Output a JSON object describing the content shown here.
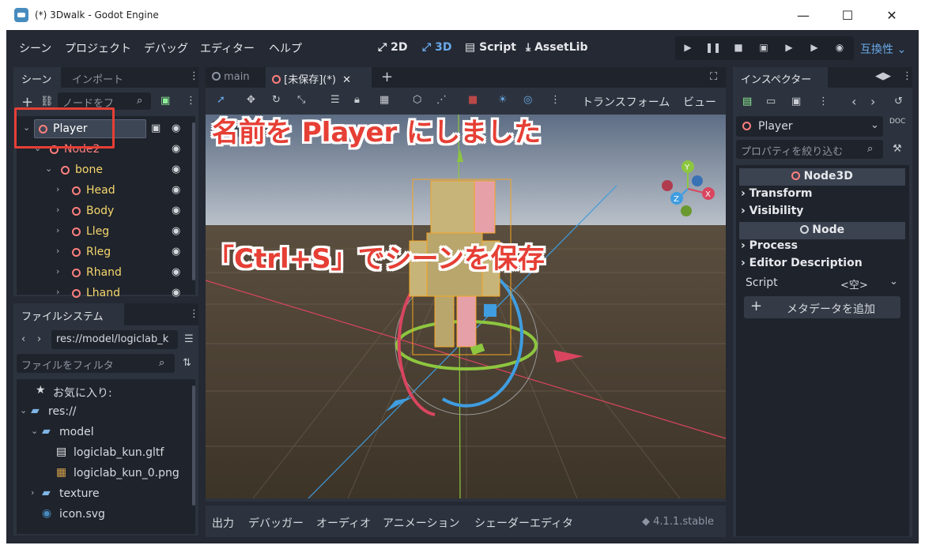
{
  "window": {
    "title": "(*) 3Dwalk - Godot Engine",
    "min": "—",
    "max": "☐",
    "close": "✕"
  },
  "menu": [
    "シーン",
    "プロジェクト",
    "デバッグ",
    "エディター",
    "ヘルプ"
  ],
  "center_tabs": {
    "t2d": "2D",
    "t3d": "3D",
    "script": "Script",
    "assetlib": "AssetLib"
  },
  "renderer": "互換性",
  "scene_dock": {
    "tab_scene": "シーン",
    "tab_import": "インポート",
    "filter_placeholder": "ノードをフ",
    "nodes": [
      {
        "name": "Player",
        "depth": 0
      },
      {
        "name": "Node2",
        "depth": 1
      },
      {
        "name": "bone",
        "depth": 2
      },
      {
        "name": "Head",
        "depth": 3
      },
      {
        "name": "Body",
        "depth": 3
      },
      {
        "name": "Lleg",
        "depth": 3
      },
      {
        "name": "Rleg",
        "depth": 3
      },
      {
        "name": "Rhand",
        "depth": 3
      },
      {
        "name": "Lhand",
        "depth": 3
      }
    ]
  },
  "fs_dock": {
    "title": "ファイルシステム",
    "path": "res://model/logiclab_k",
    "filter_placeholder": "ファイルをフィルタ",
    "items": [
      {
        "label": "お気に入り:",
        "kind": "fav"
      },
      {
        "label": "res://",
        "kind": "folder"
      },
      {
        "label": "model",
        "kind": "folder"
      },
      {
        "label": "logiclab_kun.gltf",
        "kind": "scene"
      },
      {
        "label": "logiclab_kun_0.png",
        "kind": "image"
      },
      {
        "label": "texture",
        "kind": "folder"
      },
      {
        "label": "icon.svg",
        "kind": "svg"
      }
    ]
  },
  "editor_tabs": {
    "main": "main",
    "unsaved": "[未保存](*)"
  },
  "viewport_toolbar": {
    "transform": "トランスフォーム",
    "view": "ビュー"
  },
  "bottom_tabs": [
    "出力",
    "デバッガー",
    "オーディオ",
    "アニメーション",
    "シェーダーエディタ"
  ],
  "version": "4.1.1.stable",
  "inspector": {
    "title": "インスペクター",
    "node": "Player",
    "filter_placeholder": "プロパティを絞り込む",
    "cat_node3d": "Node3D",
    "transform": "Transform",
    "visibility": "Visibility",
    "cat_node": "Node",
    "process": "Process",
    "editor_description": "Editor Description",
    "script_label": "Script",
    "script_value": "<空>",
    "add_metadata": "メタデータを追加"
  },
  "annotations": {
    "rename": "名前を Player にしました",
    "save": "「Ctrl+S」でシーンを保存"
  },
  "gizmo": {
    "y": "Y",
    "x": "X",
    "z": "Z"
  },
  "colors": {
    "accent": "#69a9e8",
    "node": "#fc7f7f",
    "callout": "#e63f35"
  }
}
